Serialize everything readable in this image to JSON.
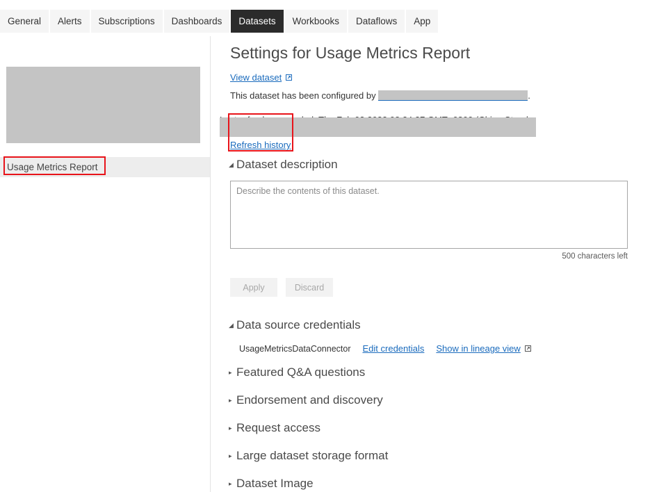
{
  "tabs": [
    {
      "label": "General",
      "active": false
    },
    {
      "label": "Alerts",
      "active": false
    },
    {
      "label": "Subscriptions",
      "active": false
    },
    {
      "label": "Dashboards",
      "active": false
    },
    {
      "label": "Datasets",
      "active": true
    },
    {
      "label": "Workbooks",
      "active": false
    },
    {
      "label": "Dataflows",
      "active": false
    },
    {
      "label": "App",
      "active": false
    }
  ],
  "sidebar": {
    "thumbnail_label": "redacted-thumbnail",
    "selected_item": "Usage Metrics Report",
    "highlight_color": "#e8131a"
  },
  "main": {
    "title": "Settings for Usage Metrics Report",
    "view_dataset_link": "View dataset",
    "external_link_icon": "external-link-icon",
    "configured_prefix": "This dataset has been configured by ",
    "configured_owner_redacted": "redacted-owner-email",
    "configured_suffix": ".",
    "last_refresh_text": "Last refresh succeeded: Thu Feb 03 2022 08:24:27 GMT+0800 (China Standard Time)",
    "refresh_history_link": "Refresh history",
    "description": {
      "header": "Dataset description",
      "expanded_caret": "◢",
      "placeholder": "Describe the contents of this dataset.",
      "value": "",
      "chars_left": "500 characters left"
    },
    "buttons": {
      "apply": "Apply",
      "discard": "Discard"
    },
    "credentials": {
      "header": "Data source credentials",
      "connector_name": "UsageMetricsDataConnector",
      "edit_link": "Edit credentials",
      "lineage_link": "Show in lineage view"
    },
    "collapsed_sections": [
      {
        "label": "Featured Q&A questions"
      },
      {
        "label": "Endorsement and discovery"
      },
      {
        "label": "Request access"
      },
      {
        "label": "Large dataset storage format"
      },
      {
        "label": "Dataset Image"
      }
    ],
    "collapsed_caret": "▸"
  },
  "colors": {
    "link": "#1a6bbd",
    "active_tab_bg": "#2b2b2b",
    "tab_bg": "#f5f5f5",
    "redaction": "#c4c4c4",
    "highlight": "#e8131a"
  }
}
